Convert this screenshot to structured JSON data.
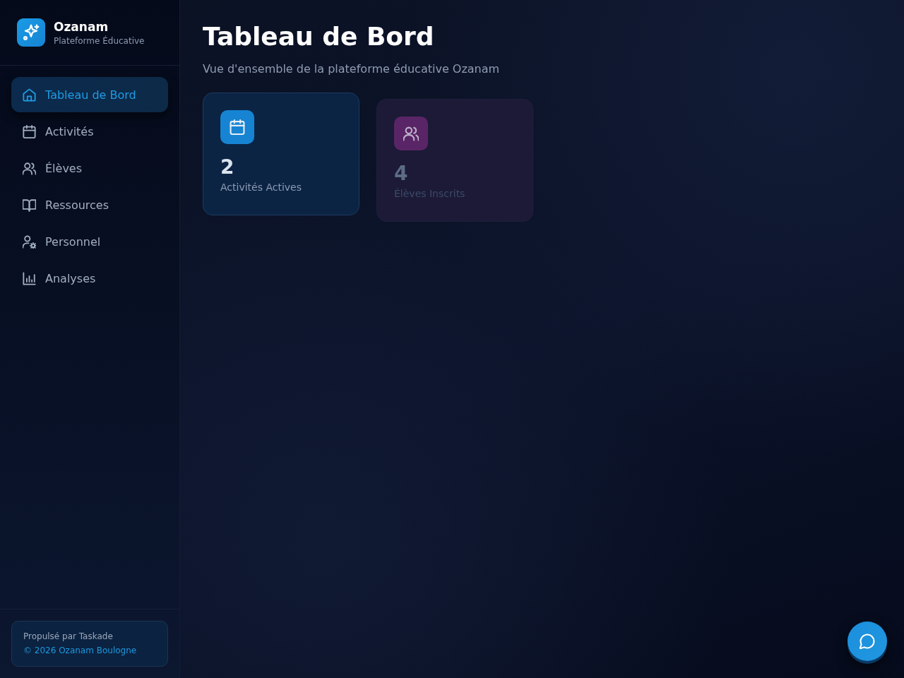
{
  "brand": {
    "name": "Ozanam",
    "tagline": "Plateforme Éducative"
  },
  "nav": [
    {
      "label": "Tableau de Bord",
      "kind": "home",
      "selected": true
    },
    {
      "label": "Activités",
      "kind": "calendar",
      "selected": false
    },
    {
      "label": "Élèves",
      "kind": "users",
      "selected": false
    },
    {
      "label": "Ressources",
      "kind": "book",
      "selected": false
    },
    {
      "label": "Personnel",
      "kind": "user-gear",
      "selected": false
    },
    {
      "label": "Analyses",
      "kind": "chart",
      "selected": false
    }
  ],
  "footer": {
    "line_1": "Propulsé par Taskade",
    "line_2": "© 2026 Ozanam Boulogne"
  },
  "header": {
    "title": "Tableau de Bord",
    "subtitle": "Vue d'ensemble de la plateforme éducative Ozanam"
  },
  "stats": [
    {
      "kind": "calendar",
      "value": "2",
      "label": "Activités Actives",
      "color": "#1684d2",
      "faded": false
    },
    {
      "kind": "users",
      "value": "4",
      "label": "Élèves Inscrits",
      "color": "#5a2566",
      "faded": true
    }
  ],
  "chat_button": {
    "kind": "chat"
  }
}
